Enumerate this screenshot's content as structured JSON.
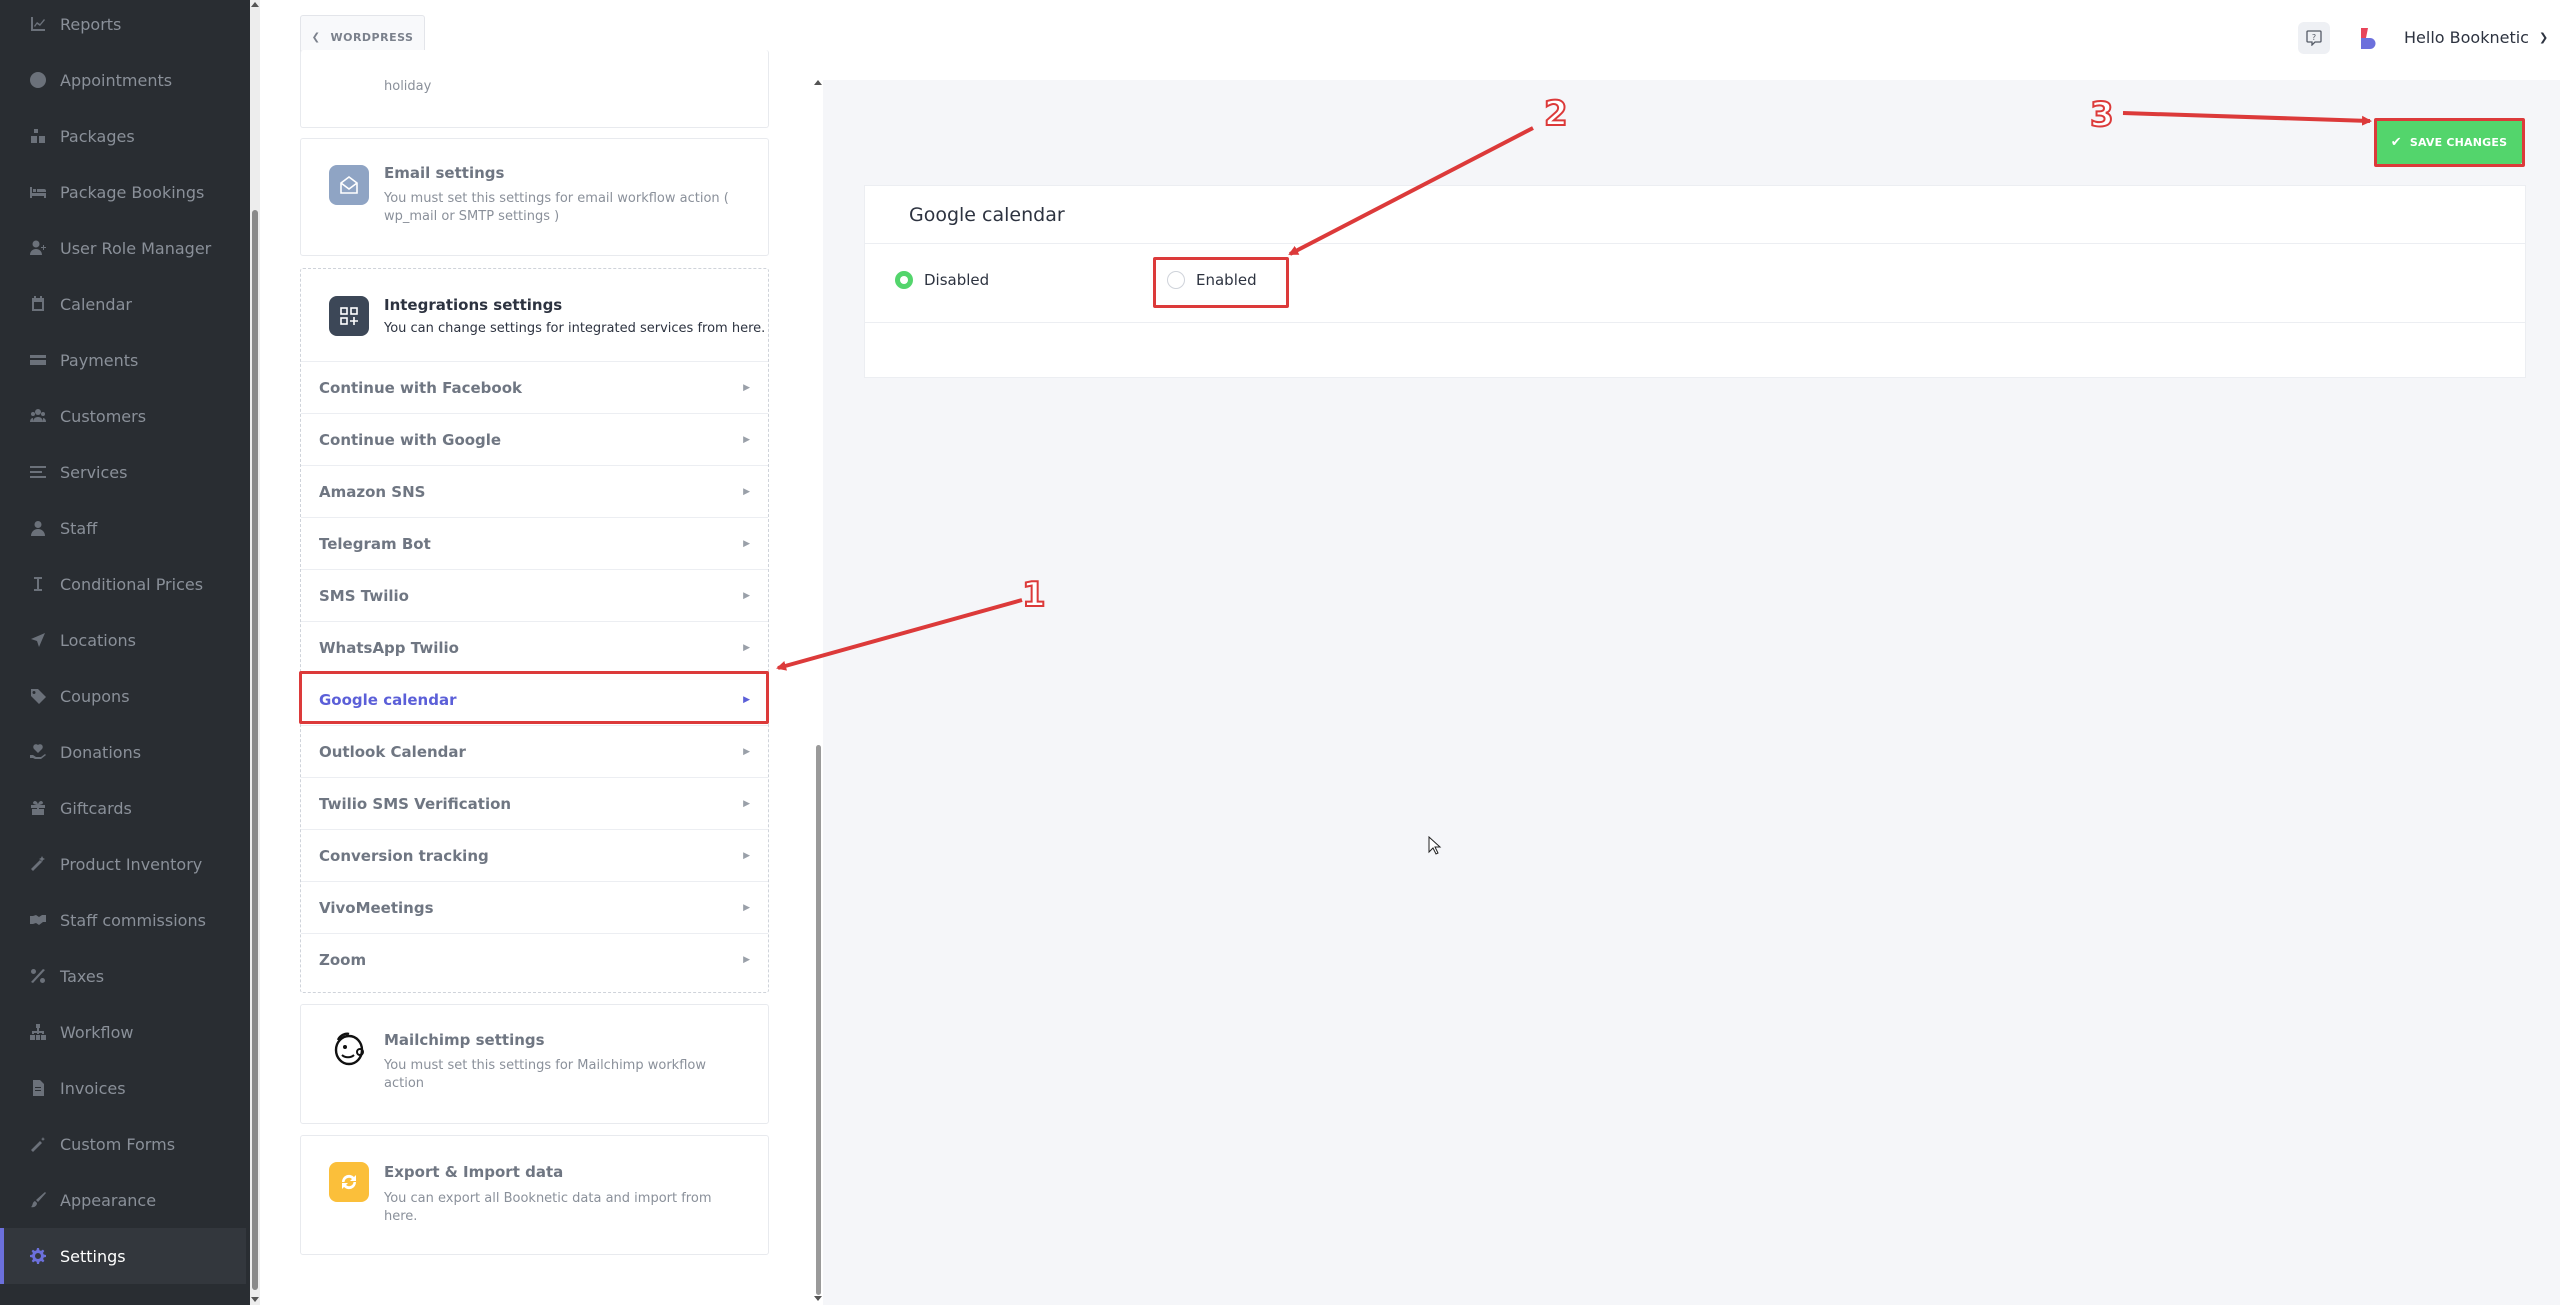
{
  "sidebar": {
    "items": [
      {
        "label": "Reports",
        "icon": "chart-icon",
        "name": "reports"
      },
      {
        "label": "Appointments",
        "icon": "clock-icon",
        "name": "appointments"
      },
      {
        "label": "Packages",
        "icon": "boxes-icon",
        "name": "packages"
      },
      {
        "label": "Package Bookings",
        "icon": "bed-icon",
        "name": "package-bookings"
      },
      {
        "label": "User Role Manager",
        "icon": "user-plus-icon",
        "name": "user-role-manager"
      },
      {
        "label": "Calendar",
        "icon": "calendar-icon",
        "name": "calendar"
      },
      {
        "label": "Payments",
        "icon": "credit-card-icon",
        "name": "payments"
      },
      {
        "label": "Customers",
        "icon": "users-icon",
        "name": "customers"
      },
      {
        "label": "Services",
        "icon": "list-icon",
        "name": "services"
      },
      {
        "label": "Staff",
        "icon": "user-icon",
        "name": "staff"
      },
      {
        "label": "Conditional Prices",
        "icon": "i-cursor-icon",
        "name": "conditional-prices"
      },
      {
        "label": "Locations",
        "icon": "location-arrow-icon",
        "name": "locations"
      },
      {
        "label": "Coupons",
        "icon": "tag-icon",
        "name": "coupons"
      },
      {
        "label": "Donations",
        "icon": "hand-heart-icon",
        "name": "donations"
      },
      {
        "label": "Giftcards",
        "icon": "gift-icon",
        "name": "giftcards"
      },
      {
        "label": "Product Inventory",
        "icon": "wand-icon",
        "name": "product-inventory"
      },
      {
        "label": "Staff commissions",
        "icon": "handshake-icon",
        "name": "staff-commissions"
      },
      {
        "label": "Taxes",
        "icon": "percent-icon",
        "name": "taxes"
      },
      {
        "label": "Workflow",
        "icon": "sitemap-icon",
        "name": "workflow"
      },
      {
        "label": "Invoices",
        "icon": "file-icon",
        "name": "invoices"
      },
      {
        "label": "Custom Forms",
        "icon": "magic-icon",
        "name": "custom-forms"
      },
      {
        "label": "Appearance",
        "icon": "brush-icon",
        "name": "appearance"
      },
      {
        "label": "Settings",
        "icon": "gear-icon",
        "name": "settings",
        "active": true
      }
    ]
  },
  "header": {
    "wordpress_label": "WORDPRESS",
    "user_greeting": "Hello Booknetic"
  },
  "settings_panel": {
    "holiday_fragment": "holiday",
    "email_card": {
      "title": "Email settings",
      "desc": "You must set this settings for email workflow action ( wp_mail or SMTP settings )"
    },
    "integrations_card": {
      "title": "Integrations settings",
      "desc": "You can change settings for integrated services from here.",
      "items": [
        {
          "label": "Continue with Facebook"
        },
        {
          "label": "Continue with Google"
        },
        {
          "label": "Amazon SNS"
        },
        {
          "label": "Telegram Bot"
        },
        {
          "label": "SMS Twilio"
        },
        {
          "label": "WhatsApp Twilio"
        },
        {
          "label": "Google calendar",
          "active": true
        },
        {
          "label": "Outlook Calendar"
        },
        {
          "label": "Twilio SMS Verification"
        },
        {
          "label": "Conversion tracking"
        },
        {
          "label": "VivoMeetings"
        },
        {
          "label": "Zoom"
        }
      ]
    },
    "mailchimp_card": {
      "title": "Mailchimp settings",
      "desc": "You must set this settings for Mailchimp workflow action"
    },
    "export_card": {
      "title": "Export & Import data",
      "desc": "You can export all Booknetic data and import from here."
    }
  },
  "main": {
    "save_label": "SAVE CHANGES",
    "section_title": "Google calendar",
    "options": [
      {
        "label": "Disabled",
        "selected": true
      },
      {
        "label": "Enabled",
        "selected": false
      }
    ]
  },
  "annotations": {
    "n1": "1",
    "n2": "2",
    "n3": "3"
  },
  "colors": {
    "accent": "#6c70dc",
    "save_green": "#53d56c",
    "annotation_red": "#dc3a3a",
    "sidebar_bg": "#292d32"
  }
}
